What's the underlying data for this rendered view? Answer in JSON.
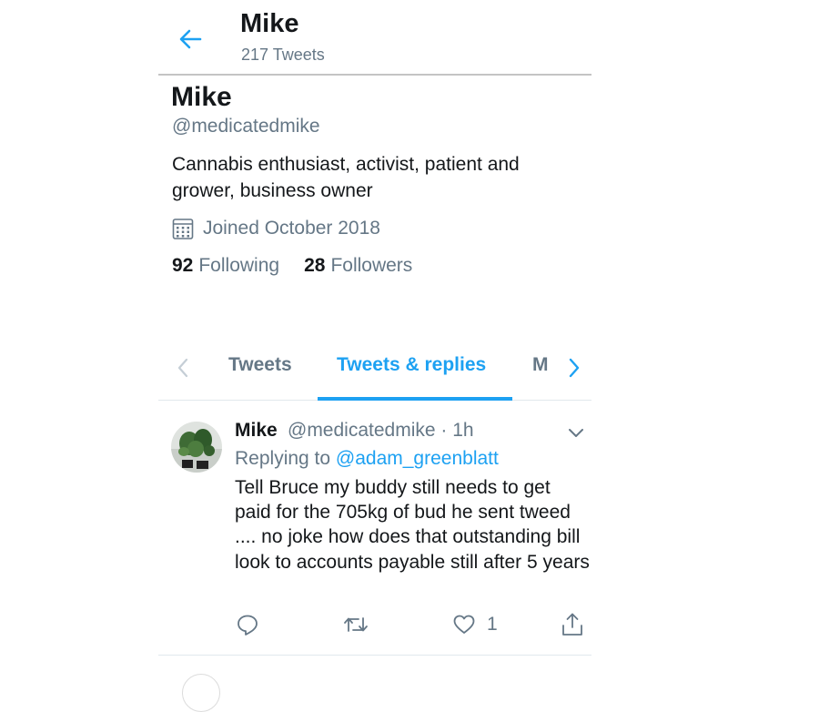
{
  "header": {
    "back_icon": "arrow-left-icon",
    "title": "Mike",
    "tweet_count": "217 Tweets"
  },
  "profile": {
    "name": "Mike",
    "handle": "@medicatedmike",
    "bio": "Cannabis enthusiast, activist, patient and grower, business owner",
    "joined_icon": "calendar-icon",
    "joined": "Joined October 2018",
    "following_count": "92",
    "following_label": "Following",
    "followers_count": "28",
    "followers_label": "Followers"
  },
  "tabs": [
    {
      "label": "Tweets",
      "active": false
    },
    {
      "label": "Tweets & replies",
      "active": true
    },
    {
      "label": "M",
      "active": false
    }
  ],
  "tweet": {
    "name": "Mike",
    "handle_time": "@medicatedmike · 1h",
    "replying_prefix": "Replying to",
    "replying_to": "@adam_greenblatt",
    "text": "Tell Bruce my buddy still needs to get paid for the 705kg of bud he sent tweed .... no joke how does that outstanding bill look to accounts payable still after 5 years",
    "like_count": "1",
    "actions": [
      "reply-icon",
      "retweet-icon",
      "like-icon",
      "share-icon"
    ]
  },
  "colors": {
    "accent": "#1da1f2",
    "secondary_text": "#657786",
    "primary_text": "#14171a",
    "divider": "#e1e8ed"
  }
}
